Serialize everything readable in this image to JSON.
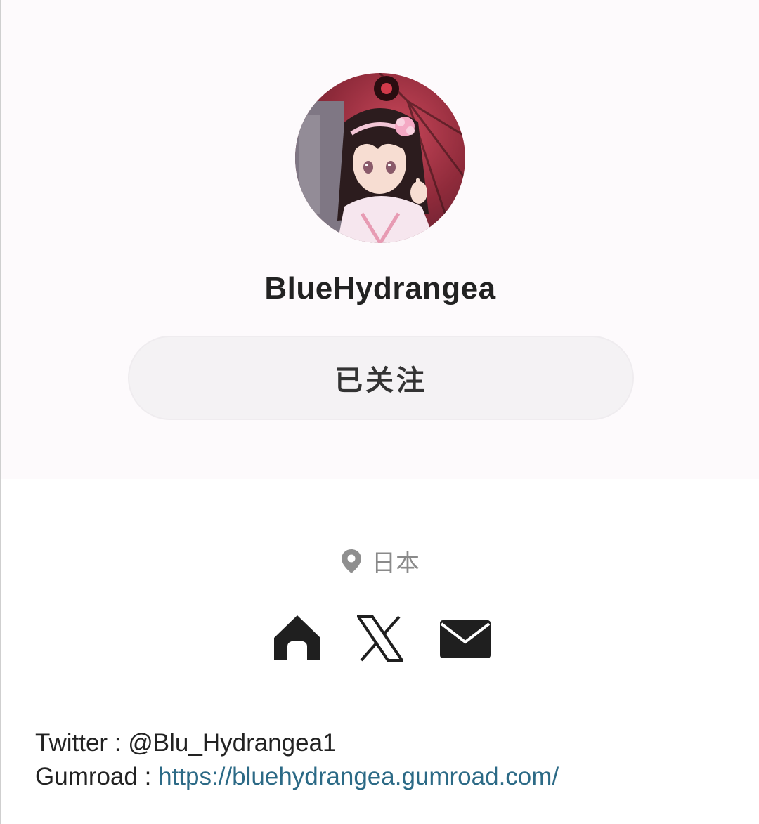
{
  "profile": {
    "username": "BlueHydrangea",
    "follow_label": "已关注",
    "avatar_icon": "user-avatar",
    "location": "日本",
    "location_icon": "location-pin-icon"
  },
  "social_links": [
    {
      "icon": "home-icon",
      "label": "home"
    },
    {
      "icon": "x-twitter-icon",
      "label": "X"
    },
    {
      "icon": "mail-icon",
      "label": "email"
    }
  ],
  "bio": {
    "twitter_label": "Twitter : @Blu_Hydrangea1",
    "gumroad_label": "Gumroad : ",
    "gumroad_url": "https://bluehydrangea.gumroad.com/"
  },
  "colors": {
    "header_bg": "#fdfafc",
    "button_bg": "#f4f2f4",
    "link": "#2c6a86",
    "muted_text": "#8a8a8a"
  }
}
